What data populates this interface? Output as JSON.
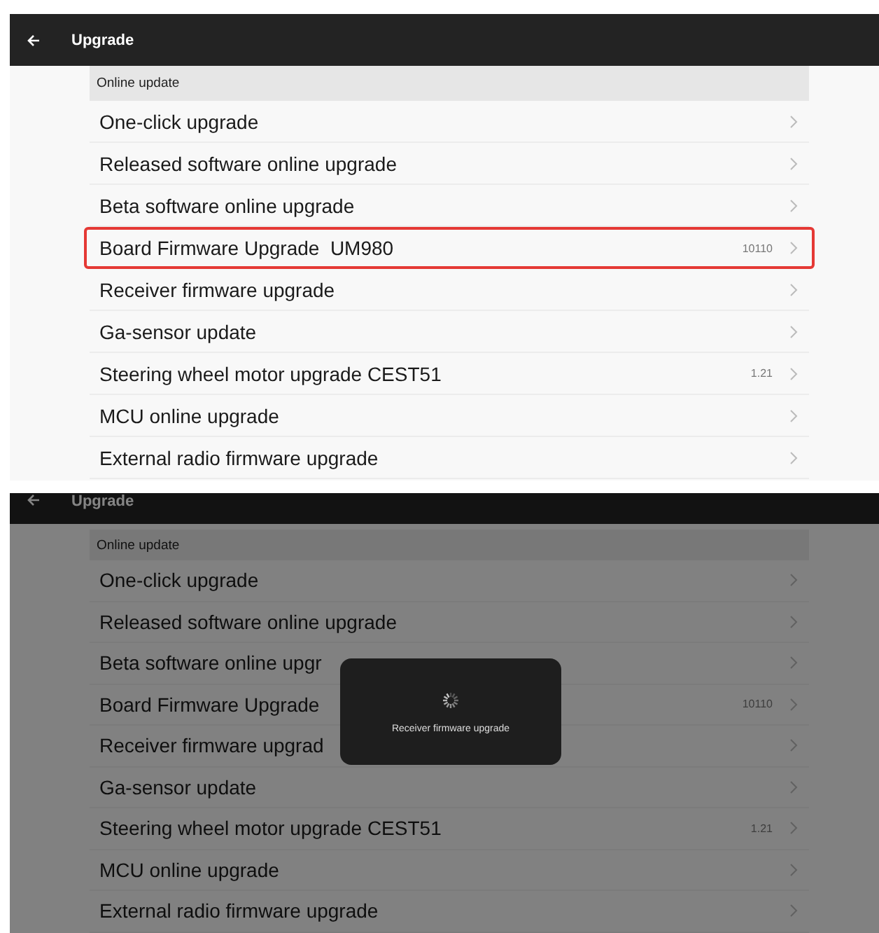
{
  "screens": [
    {
      "title": "Upgrade",
      "dimmed": false,
      "section": "Online update",
      "rows": [
        {
          "label": "One-click upgrade",
          "highlighted": false
        },
        {
          "label": "Released software online upgrade",
          "highlighted": false
        },
        {
          "label": "Beta software online upgrade",
          "highlighted": false
        },
        {
          "label": "Board Firmware Upgrade  UM980",
          "value": "10110",
          "highlighted": true
        },
        {
          "label": "Receiver firmware upgrade",
          "highlighted": false
        },
        {
          "label": "Ga-sensor update",
          "highlighted": false
        },
        {
          "label": "Steering wheel motor upgrade CEST51",
          "value": "1.21",
          "highlighted": false
        },
        {
          "label": "MCU online upgrade",
          "highlighted": false
        },
        {
          "label": "External radio firmware upgrade",
          "highlighted": false
        }
      ]
    },
    {
      "title": "Upgrade",
      "dimmed": true,
      "section": "Online update",
      "rows": [
        {
          "label": "One-click upgrade",
          "highlighted": false
        },
        {
          "label": "Released software online upgrade",
          "highlighted": false
        },
        {
          "label": "Beta software online upgr",
          "highlighted": false
        },
        {
          "label": "Board Firmware Upgrade",
          "value": "10110",
          "highlighted": false
        },
        {
          "label": "Receiver firmware upgrad",
          "highlighted": false
        },
        {
          "label": "Ga-sensor update",
          "highlighted": false
        },
        {
          "label": "Steering wheel motor upgrade CEST51",
          "value": "1.21",
          "highlighted": false
        },
        {
          "label": "MCU online upgrade",
          "highlighted": false
        },
        {
          "label": "External radio firmware upgrade",
          "highlighted": false
        }
      ],
      "dialog": {
        "message": "Receiver firmware upgrade"
      }
    }
  ]
}
